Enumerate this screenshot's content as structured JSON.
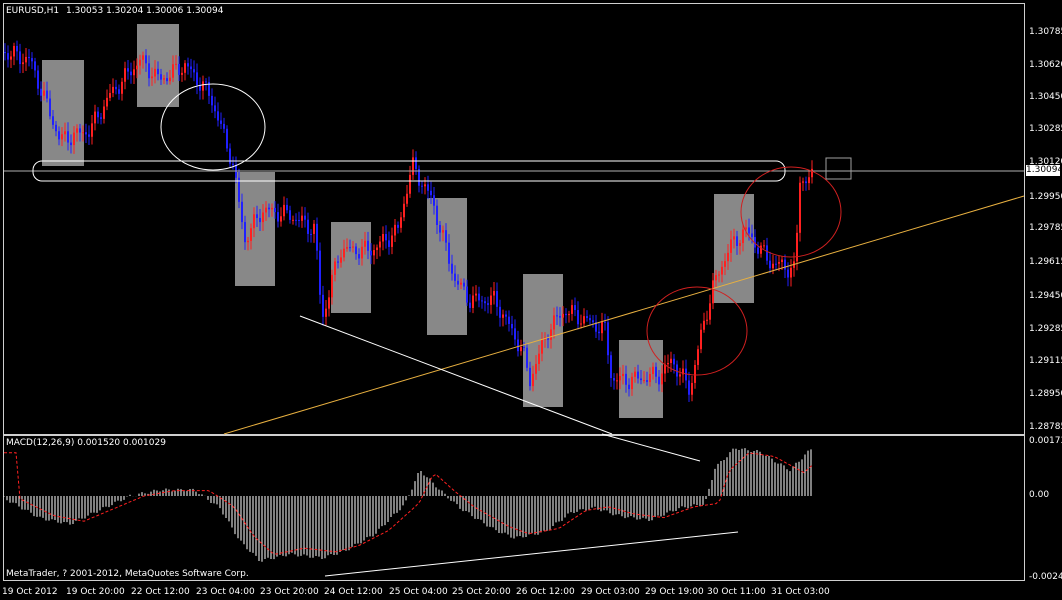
{
  "header": {
    "symbol_label": "EURUSD,H1",
    "ohlc_text": "1.30053 1.30204 1.30006 1.30094"
  },
  "price_scale": [
    "1.30785",
    "1.30620",
    "1.30450",
    "1.30285",
    "1.30120",
    "1.29950",
    "1.29785",
    "1.29615",
    "1.29450",
    "1.29285",
    "1.29115",
    "1.28950",
    "1.28785"
  ],
  "current_price": "1.30094",
  "macd": {
    "label": "MACD(12,26,9) 0.001520 0.001029",
    "scale": [
      "0.001734",
      "0.00",
      "-0.00244"
    ]
  },
  "time_axis": [
    "19 Oct 2012",
    "19 Oct 20:00",
    "22 Oct 12:00",
    "23 Oct 04:00",
    "23 Oct 20:00",
    "24 Oct 12:00",
    "25 Oct 04:00",
    "25 Oct 20:00",
    "26 Oct 12:00",
    "29 Oct 03:00",
    "29 Oct 19:00",
    "30 Oct 11:00",
    "31 Oct 03:00"
  ],
  "footer": {
    "copyright": "MetaTrader, ? 2001-2012, MetaQuotes Software Corp."
  },
  "colors": {
    "bull": "#ff2020",
    "bear": "#2020ff",
    "box": "#a0a0a0",
    "trend": "#e8b040",
    "signal": "#ff2020",
    "circle_red": "#d02020"
  }
}
